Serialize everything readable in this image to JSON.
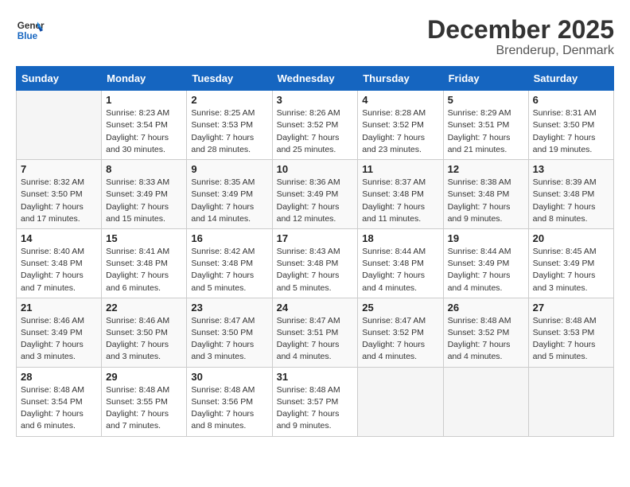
{
  "header": {
    "logo_line1": "General",
    "logo_line2": "Blue",
    "title": "December 2025",
    "subtitle": "Brenderup, Denmark"
  },
  "days_of_week": [
    "Sunday",
    "Monday",
    "Tuesday",
    "Wednesday",
    "Thursday",
    "Friday",
    "Saturday"
  ],
  "weeks": [
    [
      {
        "num": "",
        "info": ""
      },
      {
        "num": "1",
        "info": "Sunrise: 8:23 AM\nSunset: 3:54 PM\nDaylight: 7 hours\nand 30 minutes."
      },
      {
        "num": "2",
        "info": "Sunrise: 8:25 AM\nSunset: 3:53 PM\nDaylight: 7 hours\nand 28 minutes."
      },
      {
        "num": "3",
        "info": "Sunrise: 8:26 AM\nSunset: 3:52 PM\nDaylight: 7 hours\nand 25 minutes."
      },
      {
        "num": "4",
        "info": "Sunrise: 8:28 AM\nSunset: 3:52 PM\nDaylight: 7 hours\nand 23 minutes."
      },
      {
        "num": "5",
        "info": "Sunrise: 8:29 AM\nSunset: 3:51 PM\nDaylight: 7 hours\nand 21 minutes."
      },
      {
        "num": "6",
        "info": "Sunrise: 8:31 AM\nSunset: 3:50 PM\nDaylight: 7 hours\nand 19 minutes."
      }
    ],
    [
      {
        "num": "7",
        "info": "Sunrise: 8:32 AM\nSunset: 3:50 PM\nDaylight: 7 hours\nand 17 minutes."
      },
      {
        "num": "8",
        "info": "Sunrise: 8:33 AM\nSunset: 3:49 PM\nDaylight: 7 hours\nand 15 minutes."
      },
      {
        "num": "9",
        "info": "Sunrise: 8:35 AM\nSunset: 3:49 PM\nDaylight: 7 hours\nand 14 minutes."
      },
      {
        "num": "10",
        "info": "Sunrise: 8:36 AM\nSunset: 3:49 PM\nDaylight: 7 hours\nand 12 minutes."
      },
      {
        "num": "11",
        "info": "Sunrise: 8:37 AM\nSunset: 3:48 PM\nDaylight: 7 hours\nand 11 minutes."
      },
      {
        "num": "12",
        "info": "Sunrise: 8:38 AM\nSunset: 3:48 PM\nDaylight: 7 hours\nand 9 minutes."
      },
      {
        "num": "13",
        "info": "Sunrise: 8:39 AM\nSunset: 3:48 PM\nDaylight: 7 hours\nand 8 minutes."
      }
    ],
    [
      {
        "num": "14",
        "info": "Sunrise: 8:40 AM\nSunset: 3:48 PM\nDaylight: 7 hours\nand 7 minutes."
      },
      {
        "num": "15",
        "info": "Sunrise: 8:41 AM\nSunset: 3:48 PM\nDaylight: 7 hours\nand 6 minutes."
      },
      {
        "num": "16",
        "info": "Sunrise: 8:42 AM\nSunset: 3:48 PM\nDaylight: 7 hours\nand 5 minutes."
      },
      {
        "num": "17",
        "info": "Sunrise: 8:43 AM\nSunset: 3:48 PM\nDaylight: 7 hours\nand 5 minutes."
      },
      {
        "num": "18",
        "info": "Sunrise: 8:44 AM\nSunset: 3:48 PM\nDaylight: 7 hours\nand 4 minutes."
      },
      {
        "num": "19",
        "info": "Sunrise: 8:44 AM\nSunset: 3:49 PM\nDaylight: 7 hours\nand 4 minutes."
      },
      {
        "num": "20",
        "info": "Sunrise: 8:45 AM\nSunset: 3:49 PM\nDaylight: 7 hours\nand 3 minutes."
      }
    ],
    [
      {
        "num": "21",
        "info": "Sunrise: 8:46 AM\nSunset: 3:49 PM\nDaylight: 7 hours\nand 3 minutes."
      },
      {
        "num": "22",
        "info": "Sunrise: 8:46 AM\nSunset: 3:50 PM\nDaylight: 7 hours\nand 3 minutes."
      },
      {
        "num": "23",
        "info": "Sunrise: 8:47 AM\nSunset: 3:50 PM\nDaylight: 7 hours\nand 3 minutes."
      },
      {
        "num": "24",
        "info": "Sunrise: 8:47 AM\nSunset: 3:51 PM\nDaylight: 7 hours\nand 4 minutes."
      },
      {
        "num": "25",
        "info": "Sunrise: 8:47 AM\nSunset: 3:52 PM\nDaylight: 7 hours\nand 4 minutes."
      },
      {
        "num": "26",
        "info": "Sunrise: 8:48 AM\nSunset: 3:52 PM\nDaylight: 7 hours\nand 4 minutes."
      },
      {
        "num": "27",
        "info": "Sunrise: 8:48 AM\nSunset: 3:53 PM\nDaylight: 7 hours\nand 5 minutes."
      }
    ],
    [
      {
        "num": "28",
        "info": "Sunrise: 8:48 AM\nSunset: 3:54 PM\nDaylight: 7 hours\nand 6 minutes."
      },
      {
        "num": "29",
        "info": "Sunrise: 8:48 AM\nSunset: 3:55 PM\nDaylight: 7 hours\nand 7 minutes."
      },
      {
        "num": "30",
        "info": "Sunrise: 8:48 AM\nSunset: 3:56 PM\nDaylight: 7 hours\nand 8 minutes."
      },
      {
        "num": "31",
        "info": "Sunrise: 8:48 AM\nSunset: 3:57 PM\nDaylight: 7 hours\nand 9 minutes."
      },
      {
        "num": "",
        "info": ""
      },
      {
        "num": "",
        "info": ""
      },
      {
        "num": "",
        "info": ""
      }
    ]
  ]
}
